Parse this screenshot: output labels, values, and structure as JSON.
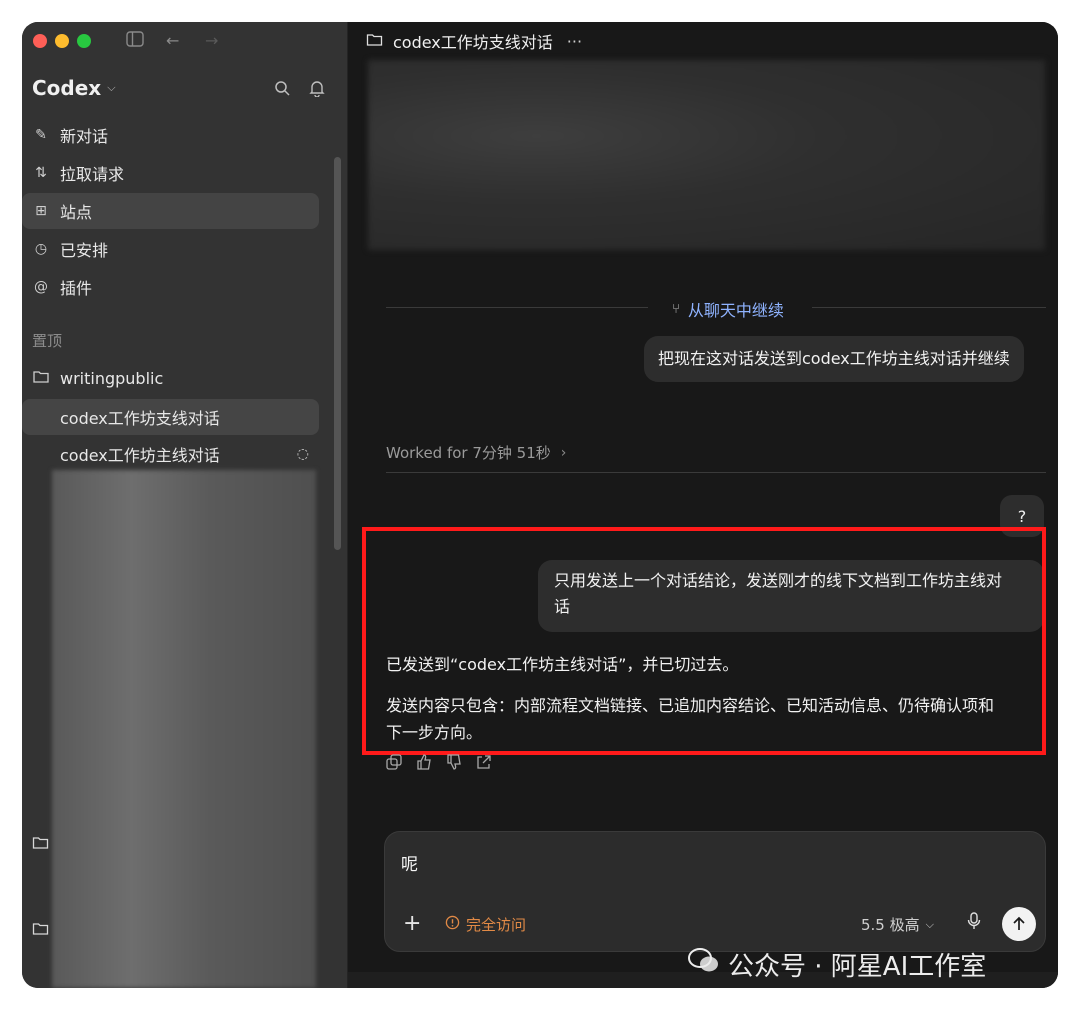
{
  "sidebar": {
    "brand": "Codex",
    "nav": [
      {
        "label": "新对话",
        "icon": "new-chat-icon"
      },
      {
        "label": "拉取请求",
        "icon": "pull-request-icon"
      },
      {
        "label": "站点",
        "icon": "sites-icon",
        "active": true
      },
      {
        "label": "已安排",
        "icon": "clock-icon"
      },
      {
        "label": "插件",
        "icon": "plugin-icon"
      }
    ],
    "pinned_label": "置顶",
    "project": "writingpublic",
    "threads": [
      {
        "label": "codex工作坊支线对话",
        "active": true
      },
      {
        "label": "codex工作坊主线对话",
        "loading": true
      }
    ]
  },
  "main": {
    "title": "codex工作坊支线对话",
    "more": "···",
    "continue_label": "从聊天中继续",
    "user_message_1": "把现在这对话发送到codex工作坊主线对话并继续",
    "worked_label": "Worked for 7分钟 51秒",
    "question_bubble": "?",
    "user_message_2_line1": "只用发送上一个对话结论，发送刚才的线下文档到工作坊主线对",
    "user_message_2_line2": "话",
    "reply_line1": "已发送到“codex工作坊主线对话”，并已切过去。",
    "reply_line2a": "发送内容只包含：内部流程文档链接、已追加内容结论、已知活动信息、仍待确认项和",
    "reply_line2b": "下一步方向。"
  },
  "composer": {
    "input_value": "呢",
    "access_label": "完全访问",
    "model_label": "5.5 极高"
  },
  "watermark": "公众号 · 阿星AI工作室",
  "colors": {
    "accent_link": "#8fb3ff",
    "access_warning": "#e28a46",
    "highlight_box": "#ff1a1a"
  }
}
